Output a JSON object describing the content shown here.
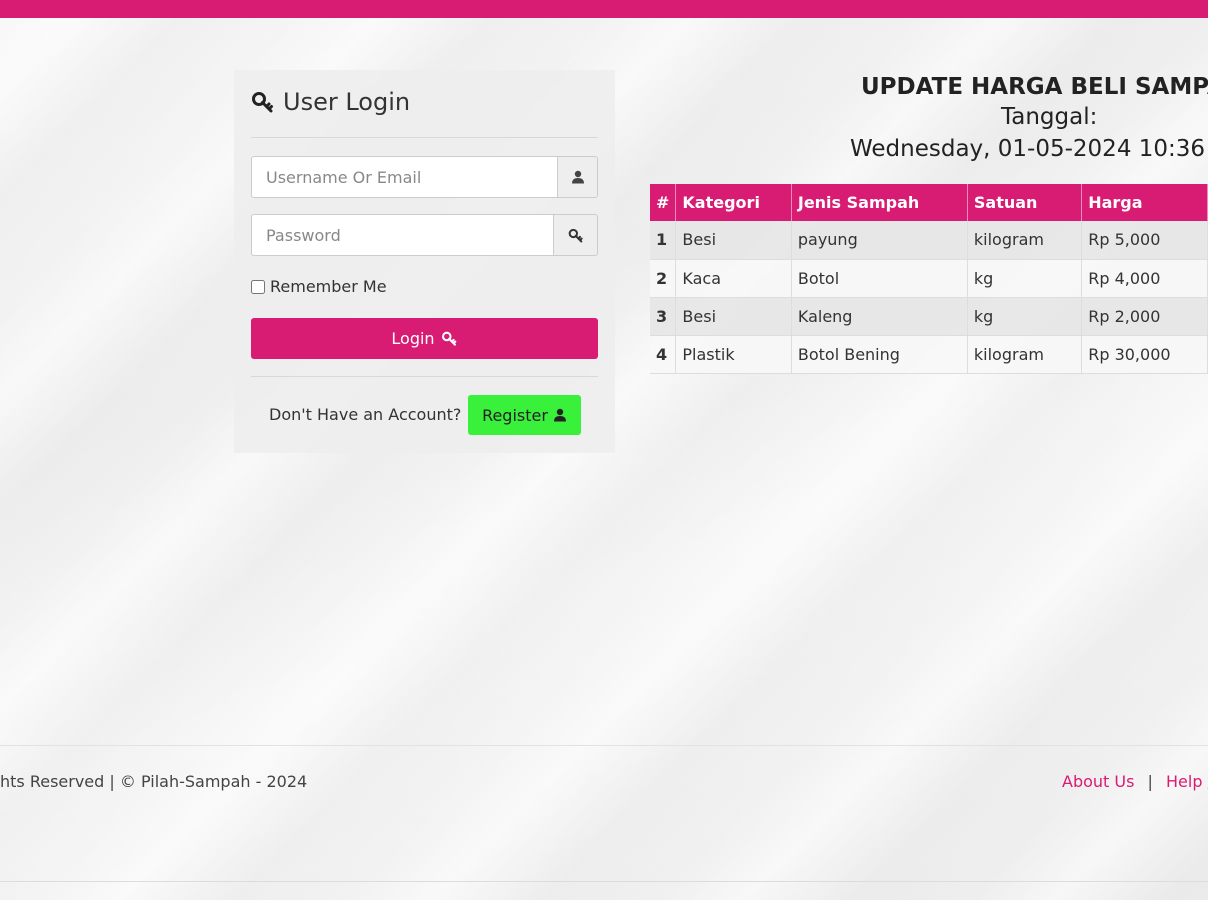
{
  "colors": {
    "accent": "#d81b73",
    "register": "#39f03a",
    "link": "#d81b73"
  },
  "login": {
    "title": "User Login",
    "title_icon": "key-icon",
    "username_placeholder": "Username Or Email",
    "username_icon": "user-icon",
    "password_placeholder": "Password",
    "password_icon": "key-icon",
    "remember_label": "Remember Me",
    "login_label": "Login",
    "account_prompt": "Don't Have an Account?",
    "register_label": "Register"
  },
  "prices": {
    "title": "UPDATE HARGA BELI SAMPA",
    "date_label": "Tanggal:",
    "date_value": "Wednesday, 01-05-2024 10:36",
    "headers": [
      "#",
      "Kategori",
      "Jenis Sampah",
      "Satuan",
      "Harga"
    ],
    "rows": [
      [
        "1",
        "Besi",
        "payung",
        "kilogram",
        "Rp 5,000"
      ],
      [
        "2",
        "Kaca",
        "Botol",
        "kg",
        "Rp 4,000"
      ],
      [
        "3",
        "Besi",
        "Kaleng",
        "kg",
        "Rp 2,000"
      ],
      [
        "4",
        "Plastik",
        "Botol Bening",
        "kilogram",
        "Rp 30,000"
      ]
    ]
  },
  "footer": {
    "copyright": "hts Reserved | © Pilah-Sampah - 2024",
    "about": "About Us",
    "separator": "|",
    "help": "Help /"
  }
}
